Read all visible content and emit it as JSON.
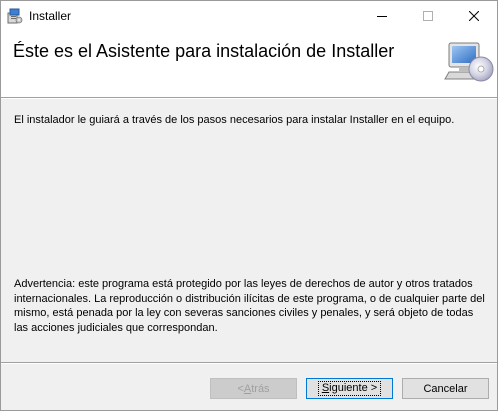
{
  "window": {
    "title": "Installer"
  },
  "header": {
    "title": "Éste es el Asistente para instalación de Installer",
    "icon": "computer-cd-icon"
  },
  "body": {
    "intro": "El instalador le guiará a través de los pasos necesarios para instalar Installer en el equipo.",
    "warning": "Advertencia: este programa está protegido por las leyes de derechos de autor y otros tratados internacionales. La reproducción o distribución ilícitas de este programa, o de cualquier parte del mismo, está penada por la ley con severas sanciones civiles y penales, y será objeto de todas las acciones judiciales que correspondan."
  },
  "buttons": {
    "back_prefix": "< ",
    "back_access": "A",
    "back_rest": "trás",
    "next_access": "S",
    "next_rest": "iguiente >",
    "cancel": "Cancelar"
  },
  "colors": {
    "accent": "#0078d7",
    "dialog_bg": "#f0f0f0",
    "header_bg": "#ffffff"
  }
}
